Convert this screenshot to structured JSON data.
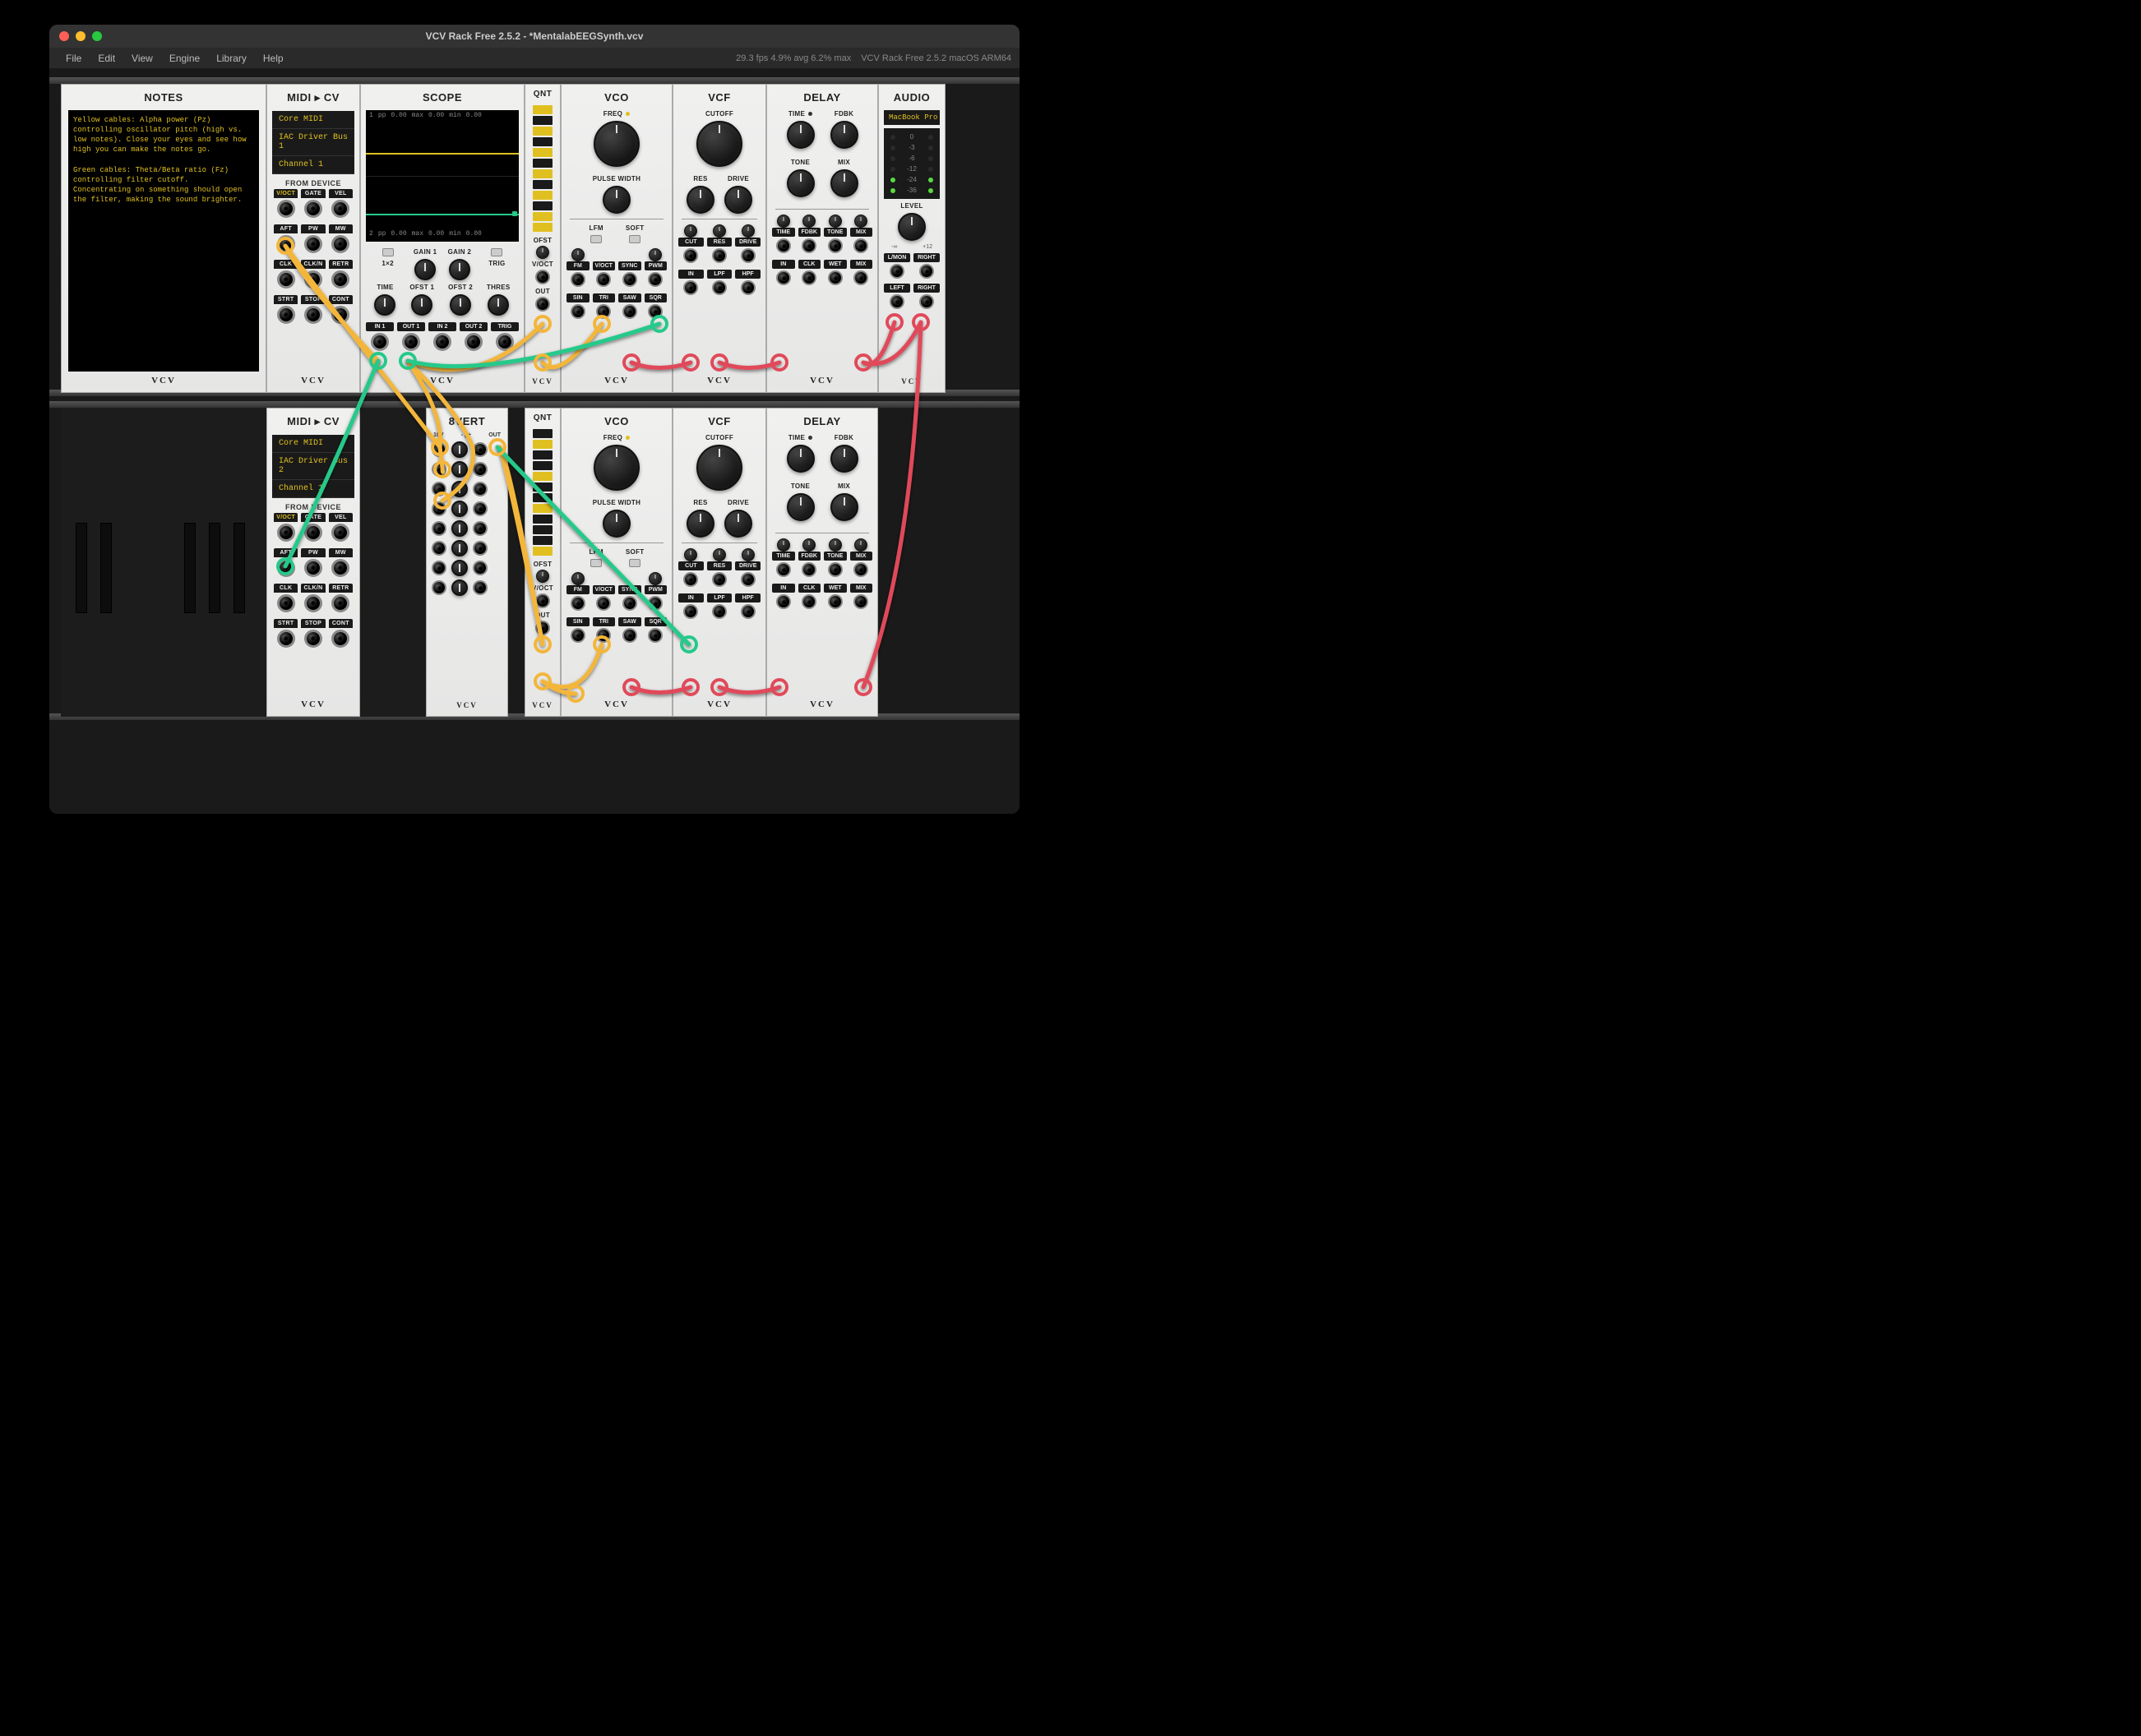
{
  "window": {
    "title": "VCV Rack Free 2.5.2 - *MentalabEEGSynth.vcv"
  },
  "menubar": {
    "items": [
      "File",
      "Edit",
      "View",
      "Engine",
      "Library",
      "Help"
    ],
    "stats": "29.3 fps  4.9% avg  6.2% max",
    "version": "VCV Rack Free 2.5.2 macOS ARM64"
  },
  "notes": {
    "title": "NOTES",
    "text": "Yellow cables: Alpha power (Pz)\ncontrolling oscillator pitch (high vs.\nlow notes). Close your eyes and see how\nhigh you can make the notes go.\n\nGreen cables: Theta/Beta ratio (Fz)\ncontrolling filter cutoff.\nConcentrating on something should open\nthe filter, making the sound brighter."
  },
  "midi1": {
    "title": "MIDI ▸ CV",
    "rows": [
      "Core MIDI",
      "IAC Driver Bus 1",
      "Channel 1"
    ],
    "from": "FROM DEVICE",
    "ports": [
      [
        "V/OCT",
        "GATE",
        "VEL"
      ],
      [
        "AFT",
        "PW",
        "MW"
      ],
      [
        "CLK",
        "CLK/N",
        "RETR"
      ],
      [
        "STRT",
        "STOP",
        "CONT"
      ]
    ]
  },
  "midi2": {
    "title": "MIDI ▸ CV",
    "rows": [
      "Core MIDI",
      "IAC Driver Bus 2",
      "Channel 1"
    ],
    "from": "FROM DEVICE",
    "ports": [
      [
        "V/OCT",
        "GATE",
        "VEL"
      ],
      [
        "AFT",
        "PW",
        "MW"
      ],
      [
        "CLK",
        "CLK/N",
        "RETR"
      ],
      [
        "STRT",
        "STOP",
        "CONT"
      ]
    ]
  },
  "scope": {
    "title": "SCOPE",
    "top": {
      "ch": "1",
      "pp": "pp",
      "v1": "0.00",
      "max": "max",
      "v2": "0.00",
      "min": "min",
      "v3": "0.00"
    },
    "bot": {
      "ch": "2",
      "pp": "pp",
      "v1": "0.00",
      "max": "max",
      "v2": "0.00",
      "min": "min",
      "v3": "0.00"
    },
    "knobs": {
      "time": "TIME",
      "g1": "GAIN 1",
      "g2": "GAIN 2",
      "o1": "OFST 1",
      "o2": "OFST 2",
      "thr": "THRES",
      "trig": "TRIG",
      "one_x_2": "1×2"
    },
    "ports": [
      "IN 1",
      "OUT 1",
      "IN 2",
      "OUT 2",
      "TRIG"
    ]
  },
  "qnt": {
    "title": "QNT",
    "ofst": "OFST",
    "voct": "V/OCT",
    "out": "OUT"
  },
  "vert": {
    "title": "8VERT",
    "hdr": {
      "l": "10V",
      "m": "- | +",
      "r": "OUT"
    }
  },
  "vco": {
    "title": "VCO",
    "freq": "FREQ",
    "pw": "PULSE WIDTH",
    "lfm": "LFM",
    "soft": "SOFT",
    "ins": [
      "FM",
      "V/OCT",
      "SYNC",
      "PWM"
    ],
    "outs": [
      "SIN",
      "TRI",
      "SAW",
      "SQR"
    ]
  },
  "vcf": {
    "title": "VCF",
    "cut": "CUTOFF",
    "res": "RES",
    "drive": "DRIVE",
    "ins": [
      "CUT",
      "RES",
      "DRIVE"
    ],
    "ports": [
      "IN",
      "LPF",
      "HPF"
    ]
  },
  "delay": {
    "title": "DELAY",
    "time": "TIME",
    "fdbk": "FDBK",
    "tone": "TONE",
    "mix": "MIX",
    "ins": [
      "TIME",
      "FDBK",
      "TONE",
      "MIX"
    ],
    "ports": [
      "IN",
      "CLK",
      "WET",
      "MIX"
    ]
  },
  "audio": {
    "title": "AUDIO",
    "device": "MacBook Pro",
    "meters": [
      "0",
      "-3",
      "-6",
      "-12",
      "-24",
      "-36"
    ],
    "level": "LEVEL",
    "range": {
      "lo": "-∞",
      "hi": "+12"
    },
    "ports": [
      "L/MON",
      "RIGHT"
    ],
    "outs": [
      "LEFT",
      "RIGHT"
    ]
  },
  "brand": "VCV"
}
